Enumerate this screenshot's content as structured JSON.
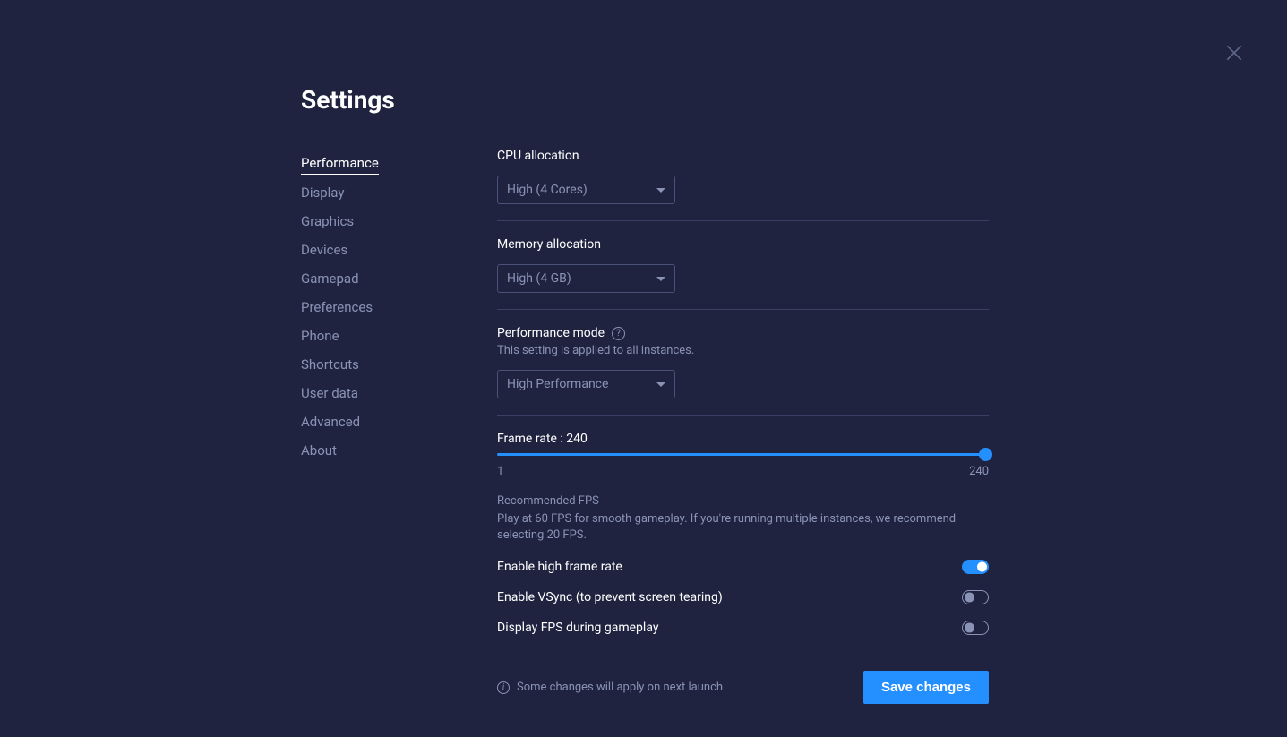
{
  "title": "Settings",
  "nav": [
    {
      "label": "Performance",
      "active": true
    },
    {
      "label": "Display"
    },
    {
      "label": "Graphics"
    },
    {
      "label": "Devices"
    },
    {
      "label": "Gamepad"
    },
    {
      "label": "Preferences"
    },
    {
      "label": "Phone"
    },
    {
      "label": "Shortcuts"
    },
    {
      "label": "User data"
    },
    {
      "label": "Advanced"
    },
    {
      "label": "About"
    }
  ],
  "cpu": {
    "label": "CPU allocation",
    "value": "High (4 Cores)"
  },
  "memory": {
    "label": "Memory allocation",
    "value": "High (4 GB)"
  },
  "perfmode": {
    "label": "Performance mode",
    "sub": "This setting is applied to all instances.",
    "value": "High Performance"
  },
  "frame": {
    "label": "Frame rate : 240",
    "min": "1",
    "max": "240",
    "rec_title": "Recommended FPS",
    "rec_text": "Play at 60 FPS for smooth gameplay. If you're running multiple instances, we recommend selecting 20 FPS."
  },
  "toggles": {
    "high_frame": {
      "label": "Enable high frame rate",
      "on": true
    },
    "vsync": {
      "label": "Enable VSync (to prevent screen tearing)",
      "on": false
    },
    "display_fps": {
      "label": "Display FPS during gameplay",
      "on": false
    }
  },
  "footer": {
    "note": "Some changes will apply on next launch",
    "save": "Save changes"
  }
}
